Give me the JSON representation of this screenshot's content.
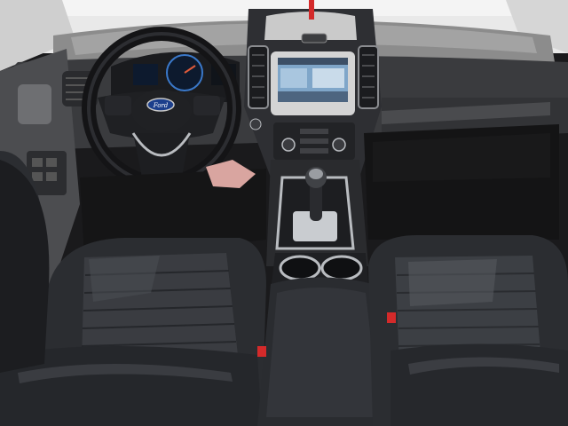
{
  "scene": {
    "subject": "vehicle-interior",
    "emblem_text": "Ford",
    "colors": {
      "dashboard": "#3a3b3e",
      "dash_top": "#8c8c8c",
      "windshield": "#e9e9e9",
      "seat_leather": "#2b2d31",
      "seat_highlight": "#4a4d52",
      "floor": "#151516",
      "screen": "#7fa6c9",
      "emblem_blue": "#1c3f8c",
      "chrome": "#b9bcc0",
      "tag_red": "#d42a2a",
      "cloth_pink": "#d9a5a0"
    }
  }
}
